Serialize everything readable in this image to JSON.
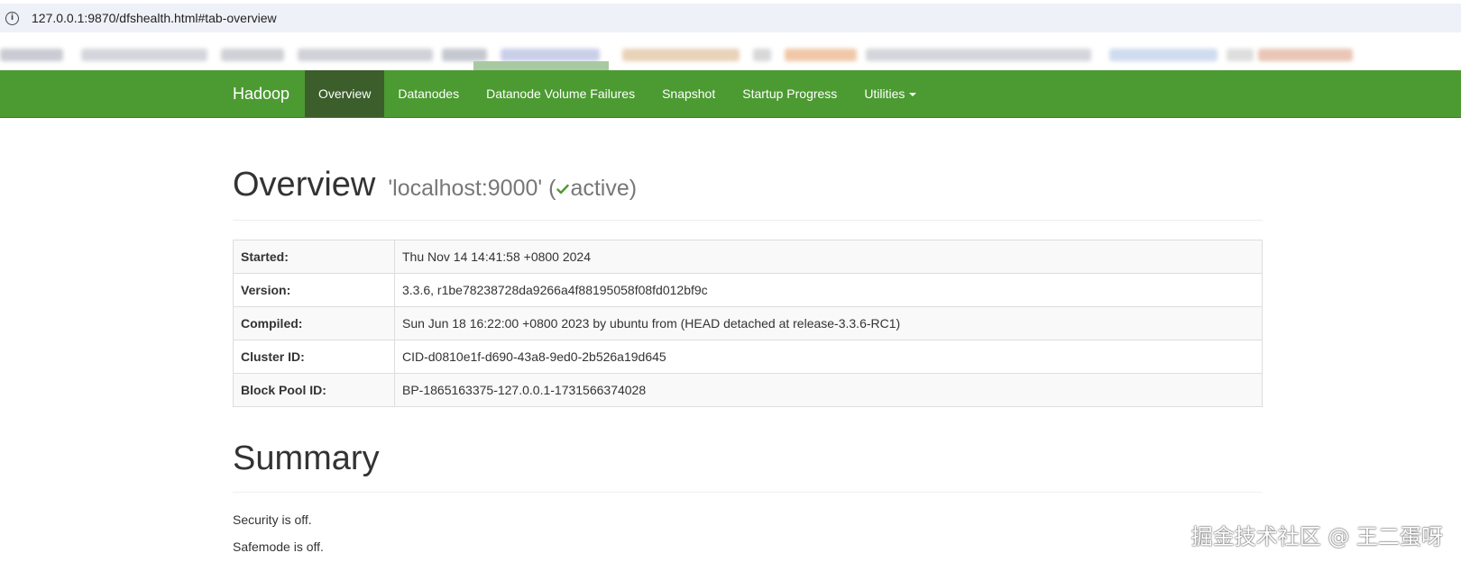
{
  "browser": {
    "url": "127.0.0.1:9870/dfshealth.html#tab-overview"
  },
  "navbar": {
    "brand": "Hadoop",
    "items": [
      {
        "label": "Overview",
        "active": true
      },
      {
        "label": "Datanodes"
      },
      {
        "label": "Datanode Volume Failures"
      },
      {
        "label": "Snapshot"
      },
      {
        "label": "Startup Progress"
      },
      {
        "label": "Utilities"
      }
    ],
    "color": "#4c9a32",
    "active_color": "#3b5e2b"
  },
  "overview": {
    "title": "Overview",
    "host": "'localhost:9000' (",
    "state": "active)",
    "check_color": "#4c9a32",
    "rows": [
      {
        "key": "Started:",
        "value": "Thu Nov 14 14:41:58 +0800 2024"
      },
      {
        "key": "Version:",
        "value": "3.3.6, r1be78238728da9266a4f88195058f08fd012bf9c"
      },
      {
        "key": "Compiled:",
        "value": "Sun Jun 18 16:22:00 +0800 2023 by ubuntu from (HEAD detached at release-3.3.6-RC1)"
      },
      {
        "key": "Cluster ID:",
        "value": "CID-d0810e1f-d690-43a8-9ed0-2b526a19d645"
      },
      {
        "key": "Block Pool ID:",
        "value": "BP-1865163375-127.0.0.1-1731566374028"
      }
    ]
  },
  "summary": {
    "title": "Summary",
    "security": "Security is off.",
    "safemode": "Safemode is off."
  },
  "watermark": "掘金技术社区 @ 王二蛋呀"
}
